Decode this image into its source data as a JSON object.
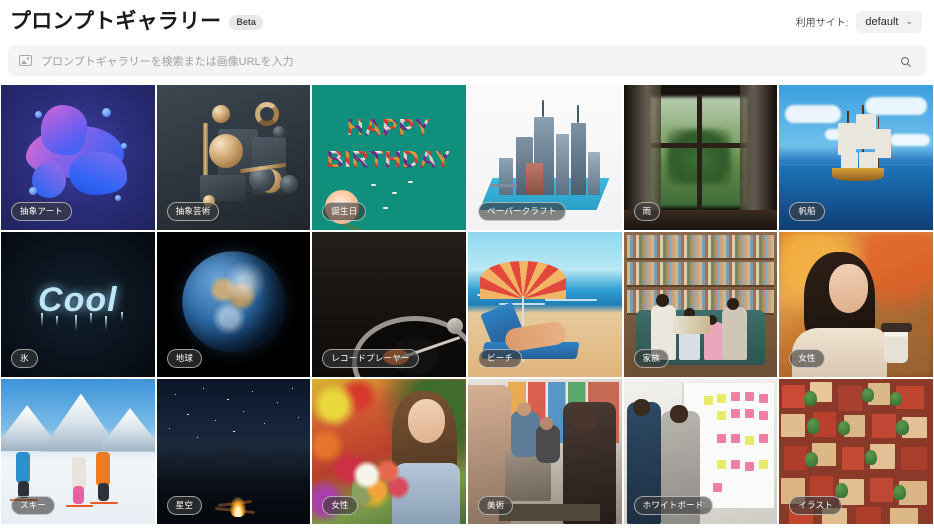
{
  "header": {
    "title": "プロンプトギャラリー",
    "badge": "Beta",
    "site_label": "利用サイト:",
    "site_value": "default",
    "chevron": "⌄"
  },
  "search": {
    "placeholder": "プロンプトギャラリーを検索または画像URLを入力",
    "image_icon": "image-icon",
    "search_icon": "search-icon"
  },
  "gallery": {
    "tiles": [
      {
        "tag": "抽象アート",
        "art": "abstract-blob"
      },
      {
        "tag": "抽象芸術",
        "art": "3d-shapes"
      },
      {
        "tag": "誕生日",
        "art": "happy-birthday"
      },
      {
        "tag": "ペーパークラフト",
        "art": "papercraft-city"
      },
      {
        "tag": "雨",
        "art": "rainy-window"
      },
      {
        "tag": "帆船",
        "art": "sailing-ship"
      },
      {
        "tag": "氷",
        "art": "cool-ice"
      },
      {
        "tag": "地球",
        "art": "earth-globe"
      },
      {
        "tag": "レコードプレーヤー",
        "art": "turntable"
      },
      {
        "tag": "ビーチ",
        "art": "beach-illustration"
      },
      {
        "tag": "家族",
        "art": "family-library"
      },
      {
        "tag": "女性",
        "art": "autumn-woman"
      },
      {
        "tag": "スキー",
        "art": "skiers"
      },
      {
        "tag": "星空",
        "art": "starry-campfire"
      },
      {
        "tag": "女性",
        "art": "woman-flowers"
      },
      {
        "tag": "美術",
        "art": "art-class"
      },
      {
        "tag": "ホワイトボード",
        "art": "whiteboard-meeting"
      },
      {
        "tag": "イラスト",
        "art": "illustrated-town"
      }
    ],
    "bday_text_line1": "HAPPY",
    "bday_text_line2": "BIRTHDAY",
    "ice_text": "Cool"
  },
  "colors": {
    "page_bg": "#ffffff",
    "search_bg": "#f4f4f4",
    "badge_bg": "#e8e8e8",
    "select_bg": "#f2f2f2",
    "tag_bg": "rgba(60,60,60,.62)",
    "title_color": "#1a1a1a"
  }
}
